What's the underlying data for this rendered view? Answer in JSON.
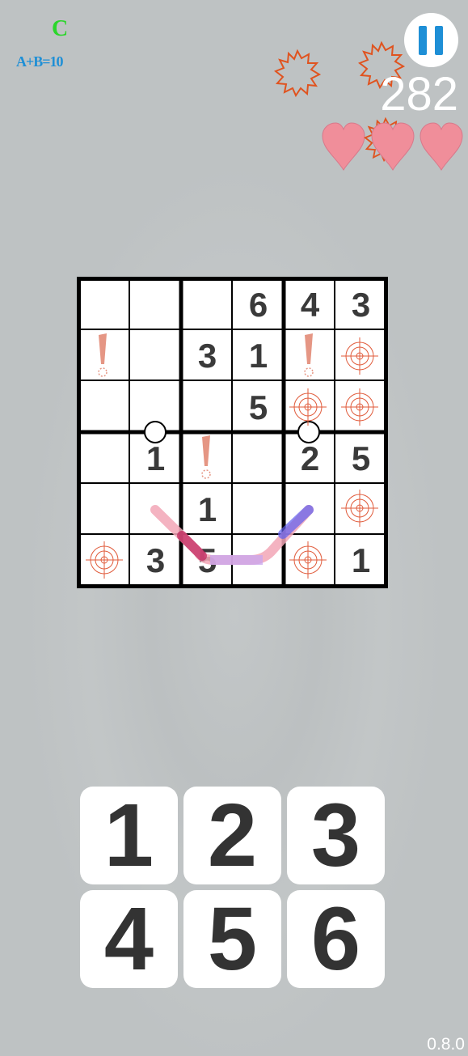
{
  "hud": {
    "letter": "C",
    "rule": "A+B=10",
    "score": "282",
    "lives": 3
  },
  "board": {
    "rows": [
      [
        "",
        "",
        "",
        "6",
        "4",
        "3"
      ],
      [
        "",
        "",
        "3",
        "1",
        "",
        ""
      ],
      [
        "",
        "",
        "",
        "5",
        "",
        ""
      ],
      [
        "",
        "1",
        "",
        "",
        "2",
        "5"
      ],
      [
        "",
        "",
        "1",
        "",
        "",
        ""
      ],
      [
        "",
        "3",
        "5",
        "",
        "",
        "1"
      ]
    ]
  },
  "keypad": {
    "keys": [
      "1",
      "2",
      "3",
      "4",
      "5",
      "6"
    ]
  },
  "version": "0.8.0",
  "colors": {
    "accent": "#1e8fd6",
    "letter": "#2bd62b",
    "heart": "#f08e9a",
    "burst": "#e0531f",
    "target": "#e05a3a",
    "exclaim": "#e59684"
  },
  "icons": {
    "pause": "pause-icon",
    "life": "heart-icon",
    "burst": "burst-icon",
    "target": "target-icon",
    "warning": "exclamation-icon",
    "dot": "circle-dot-icon"
  }
}
